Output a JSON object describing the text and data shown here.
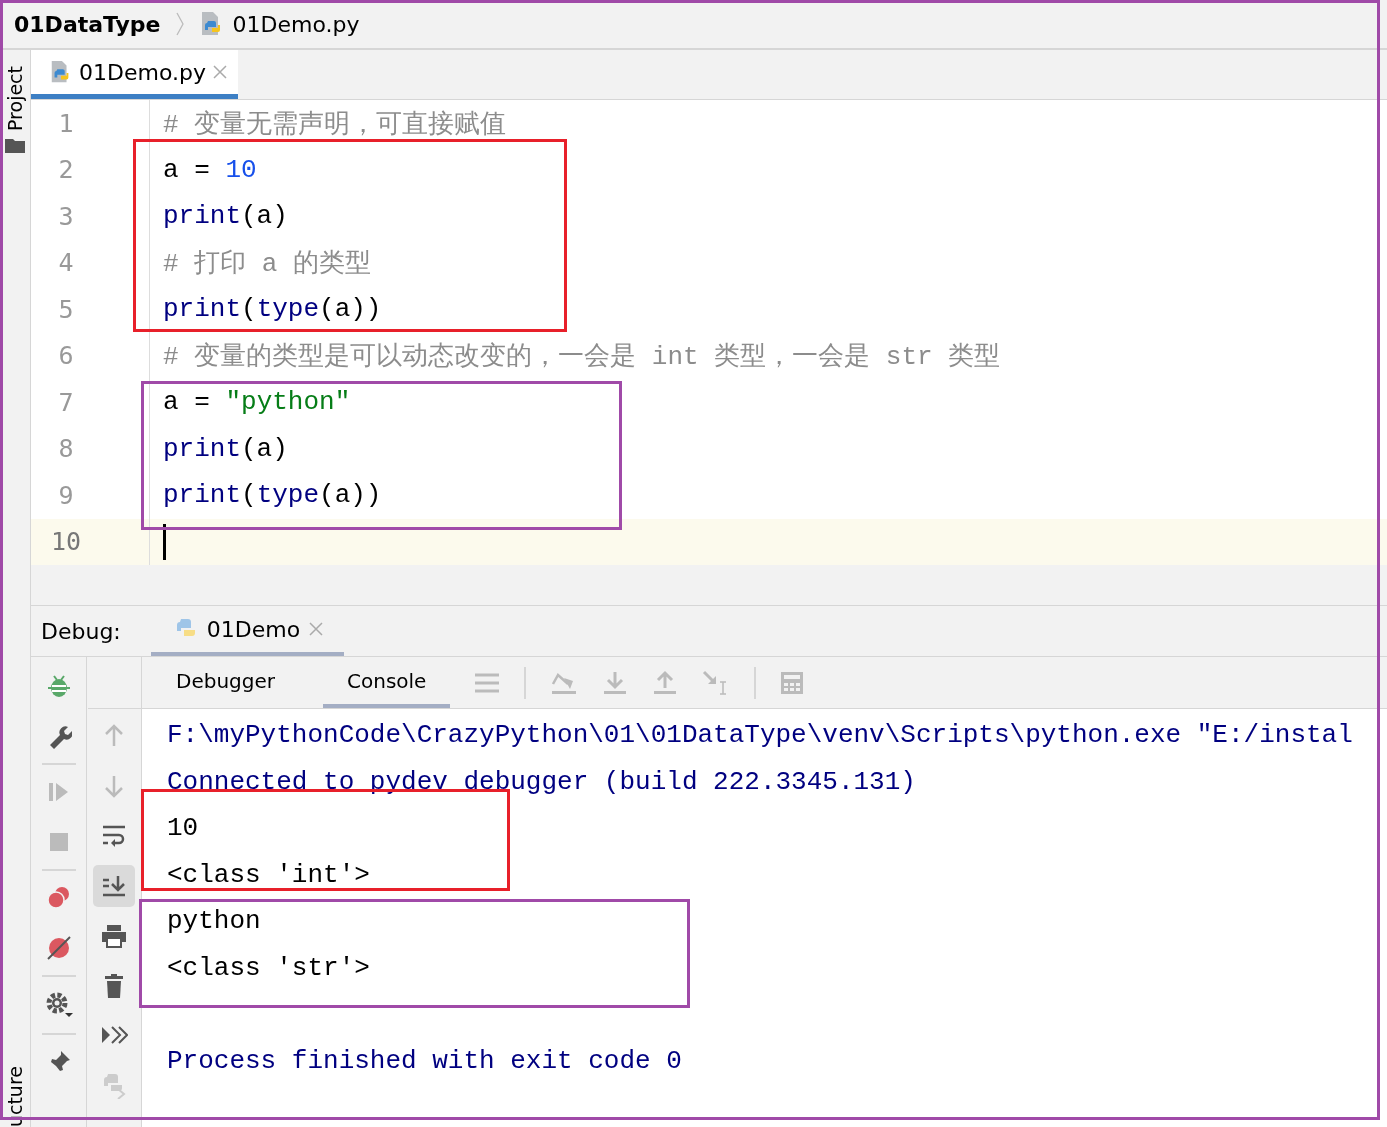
{
  "breadcrumb": [
    {
      "label": "01DataType",
      "kind": "folder"
    },
    {
      "label": "01Demo.py",
      "kind": "file"
    }
  ],
  "side_labels": {
    "top": "Project",
    "bottom": "ucture"
  },
  "editor_tabs": [
    {
      "label": "01Demo.py",
      "selected": true
    }
  ],
  "code_lines": [
    {
      "number": "1",
      "current": false,
      "tokens": [
        {
          "kind": "comment",
          "text": "# 变量无需声明，可直接赋值"
        }
      ]
    },
    {
      "number": "2",
      "current": false,
      "tokens": [
        {
          "kind": "plain",
          "text": "a = "
        },
        {
          "kind": "number",
          "text": "10"
        }
      ]
    },
    {
      "number": "3",
      "current": false,
      "tokens": [
        {
          "kind": "builtin",
          "text": "print"
        },
        {
          "kind": "plain",
          "text": "(a)"
        }
      ]
    },
    {
      "number": "4",
      "current": false,
      "tokens": [
        {
          "kind": "comment",
          "text": "# 打印 a 的类型"
        }
      ]
    },
    {
      "number": "5",
      "current": false,
      "tokens": [
        {
          "kind": "builtin",
          "text": "print"
        },
        {
          "kind": "plain",
          "text": "("
        },
        {
          "kind": "builtin",
          "text": "type"
        },
        {
          "kind": "plain",
          "text": "(a))"
        }
      ]
    },
    {
      "number": "6",
      "current": false,
      "tokens": [
        {
          "kind": "comment",
          "text": "# 变量的类型是可以动态改变的，一会是 int 类型，一会是 str 类型"
        }
      ]
    },
    {
      "number": "7",
      "current": false,
      "tokens": [
        {
          "kind": "plain",
          "text": "a = "
        },
        {
          "kind": "string",
          "text": "\"python\""
        }
      ]
    },
    {
      "number": "8",
      "current": false,
      "tokens": [
        {
          "kind": "builtin",
          "text": "print"
        },
        {
          "kind": "plain",
          "text": "(a)"
        }
      ]
    },
    {
      "number": "9",
      "current": false,
      "tokens": [
        {
          "kind": "builtin",
          "text": "print"
        },
        {
          "kind": "plain",
          "text": "("
        },
        {
          "kind": "builtin",
          "text": "type"
        },
        {
          "kind": "plain",
          "text": "(a))"
        }
      ]
    },
    {
      "number": "10",
      "current": true
    }
  ],
  "debug": {
    "label": "Debug:",
    "sessions": [
      {
        "label": "01Demo",
        "selected": true
      }
    ],
    "tabs": [
      {
        "label": "Debugger",
        "selected": false
      },
      {
        "label": "Console",
        "selected": true
      }
    ],
    "scroll_to_end_active": true
  },
  "console_lines": [
    {
      "kind": "system",
      "text": "F:\\myPythonCode\\CrazyPython\\01\\01DataType\\venv\\Scripts\\python.exe \"E:/instal"
    },
    {
      "kind": "system",
      "text": "Connected to pydev debugger (build 222.3345.131)"
    },
    {
      "kind": "output",
      "text": "10"
    },
    {
      "kind": "output",
      "text": "<class 'int'>"
    },
    {
      "kind": "output",
      "text": "python"
    },
    {
      "kind": "output",
      "text": "<class 'str'>"
    },
    {
      "kind": "blank"
    },
    {
      "kind": "system",
      "text": "Process finished with exit code 0"
    }
  ],
  "annotations": [
    {
      "color": "#e8202a"
    },
    {
      "color": "#a04aa8"
    },
    {
      "color": "#e8202a"
    },
    {
      "color": "#a04aa8"
    }
  ],
  "frame": {
    "color": "#a04aa8"
  }
}
